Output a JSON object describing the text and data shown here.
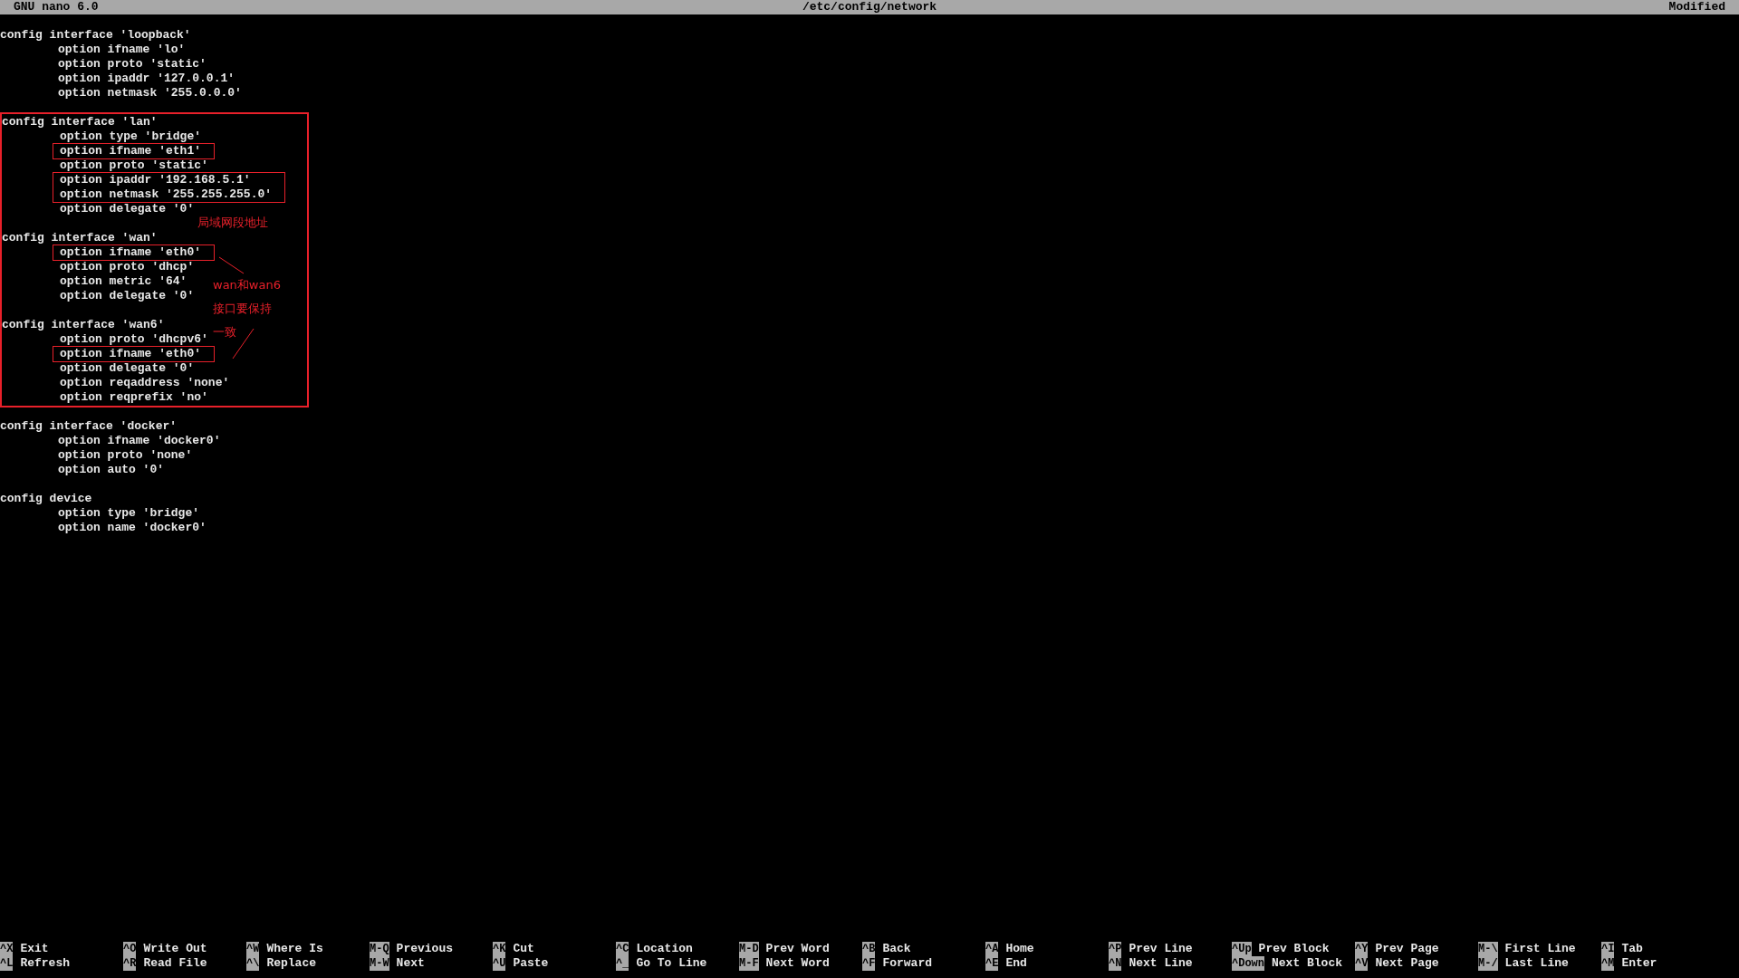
{
  "title_bar": {
    "app": "GNU nano 6.0",
    "file": "/etc/config/network",
    "status": "Modified"
  },
  "blocks": [
    {
      "outlined": false,
      "sections": [
        {
          "header": "config interface 'loopback'",
          "options": [
            {
              "text": "option ifname 'lo'",
              "marked": false
            },
            {
              "text": "option proto 'static'",
              "marked": false
            },
            {
              "text": "option ipaddr '127.0.0.1'",
              "marked": false
            },
            {
              "text": "option netmask '255.0.0.0'",
              "marked": false
            }
          ]
        }
      ]
    },
    {
      "outlined": true,
      "sections": [
        {
          "header": "config interface 'lan'",
          "options": [
            {
              "text": "option type 'bridge'",
              "marked": false
            },
            {
              "text": "option ifname 'eth1'",
              "marked": true
            },
            {
              "text": "option proto 'static'",
              "marked": false
            },
            {
              "text": "option ipaddr '192.168.5.1'",
              "marked": true
            },
            {
              "text": "option netmask '255.255.255.0'",
              "marked": true
            },
            {
              "text": "option delegate '0'",
              "marked": false
            }
          ]
        },
        {
          "header": "config interface 'wan'",
          "options": [
            {
              "text": "option ifname 'eth0'",
              "marked": true
            },
            {
              "text": "option proto 'dhcp'",
              "marked": false
            },
            {
              "text": "option metric '64'",
              "marked": false
            },
            {
              "text": "option delegate '0'",
              "marked": false
            }
          ]
        },
        {
          "header": "config interface 'wan6'",
          "options": [
            {
              "text": "option proto 'dhcpv6'",
              "marked": false
            },
            {
              "text": "option ifname 'eth0'",
              "marked": true
            },
            {
              "text": "option delegate '0'",
              "marked": false
            },
            {
              "text": "option reqaddress 'none'",
              "marked": false
            },
            {
              "text": "option reqprefix 'no'",
              "marked": false
            }
          ]
        }
      ]
    },
    {
      "outlined": false,
      "sections": [
        {
          "header": "config interface 'docker'",
          "options": [
            {
              "text": "option ifname 'docker0'",
              "marked": false
            },
            {
              "text": "option proto 'none'",
              "marked": false
            },
            {
              "text": "option auto '0'",
              "marked": false
            }
          ]
        },
        {
          "header": "config device",
          "options": [
            {
              "text": "option type 'bridge'",
              "marked": false
            },
            {
              "text": "option name 'docker0'",
              "marked": false
            }
          ]
        }
      ]
    }
  ],
  "annotations": {
    "lan_note": "局域网段地址",
    "wan_note": [
      "wan和wan6",
      "接口要保持",
      "一致"
    ]
  },
  "shortcut_rows": [
    [
      {
        "key": "^X",
        "label": "Exit"
      },
      {
        "key": "^O",
        "label": "Write Out"
      },
      {
        "key": "^W",
        "label": "Where Is"
      },
      {
        "key": "M-Q",
        "label": "Previous"
      },
      {
        "key": "^K",
        "label": "Cut"
      },
      {
        "key": "^C",
        "label": "Location"
      },
      {
        "key": "M-D",
        "label": "Prev Word"
      },
      {
        "key": "^B",
        "label": "Back"
      },
      {
        "key": "^A",
        "label": "Home"
      },
      {
        "key": "^P",
        "label": "Prev Line"
      },
      {
        "key": "^Up",
        "label": "Prev Block"
      },
      {
        "key": "^Y",
        "label": "Prev Page"
      },
      {
        "key": "M-\\",
        "label": "First Line"
      },
      {
        "key": "^I",
        "label": "Tab"
      }
    ],
    [
      {
        "key": "^L",
        "label": "Refresh"
      },
      {
        "key": "^R",
        "label": "Read File"
      },
      {
        "key": "^\\",
        "label": "Replace"
      },
      {
        "key": "M-W",
        "label": "Next"
      },
      {
        "key": "^U",
        "label": "Paste"
      },
      {
        "key": "^_",
        "label": "Go To Line"
      },
      {
        "key": "M-F",
        "label": "Next Word"
      },
      {
        "key": "^F",
        "label": "Forward"
      },
      {
        "key": "^E",
        "label": "End"
      },
      {
        "key": "^N",
        "label": "Next Line"
      },
      {
        "key": "^Down",
        "label": "Next Block"
      },
      {
        "key": "^V",
        "label": "Next Page"
      },
      {
        "key": "M-/",
        "label": "Last Line"
      },
      {
        "key": "^M",
        "label": "Enter"
      }
    ]
  ]
}
